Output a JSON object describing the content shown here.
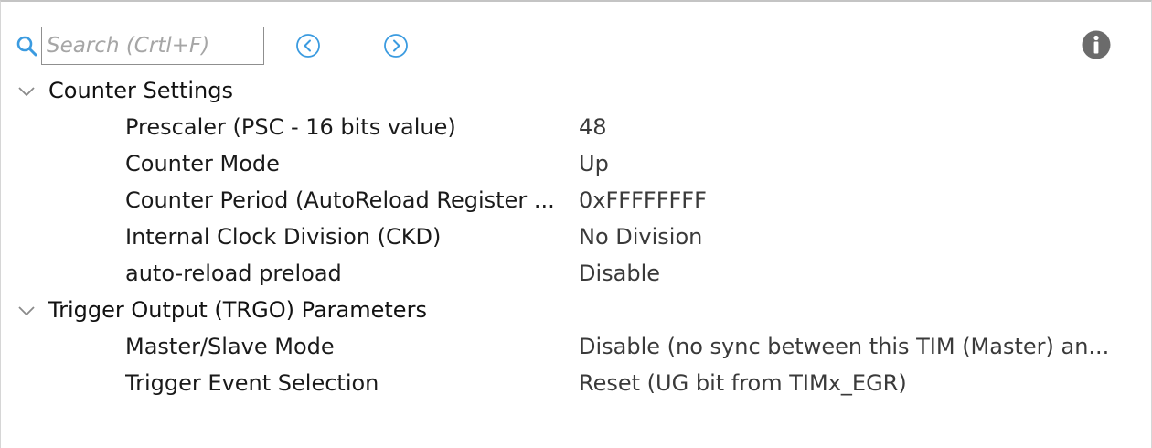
{
  "search": {
    "placeholder": "Search (Crtl+F)"
  },
  "icons": {
    "search": "search-icon",
    "previous": "chevron-left-circle-icon",
    "next": "chevron-right-circle-icon",
    "info": "info-icon",
    "expand": "chevron-down-icon"
  },
  "colors": {
    "accent": "#3b9be0",
    "info": "#6b6b6b"
  },
  "groups": [
    {
      "label": "Counter Settings",
      "expanded": true,
      "params": [
        {
          "name": "Prescaler (PSC - 16 bits value)",
          "value": "48"
        },
        {
          "name": "Counter Mode",
          "value": "Up"
        },
        {
          "name": "Counter Period (AutoReload Register ...",
          "value": "0xFFFFFFFF"
        },
        {
          "name": "Internal Clock Division (CKD)",
          "value": "No Division"
        },
        {
          "name": "auto-reload preload",
          "value": "Disable"
        }
      ]
    },
    {
      "label": "Trigger Output (TRGO) Parameters",
      "expanded": true,
      "params": [
        {
          "name": "Master/Slave Mode",
          "value": "Disable (no sync between this TIM (Master) an..."
        },
        {
          "name": "Trigger Event Selection",
          "value": "Reset (UG bit from TIMx_EGR)"
        }
      ]
    }
  ]
}
